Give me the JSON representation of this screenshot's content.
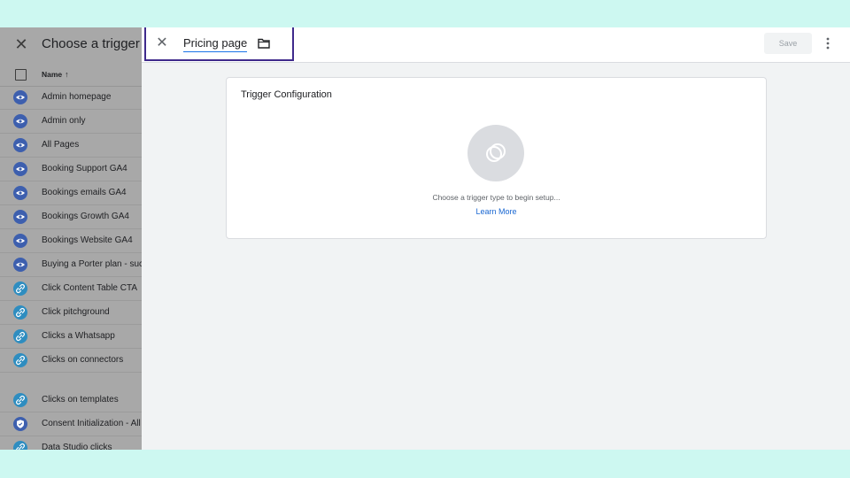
{
  "left_panel": {
    "close_icon": "close-icon",
    "title": "Choose a trigger",
    "column_header": {
      "name": "Name",
      "sort_arrow": "↑"
    },
    "triggers": [
      {
        "name": "Admin homepage",
        "icon": "pageview-eye-icon"
      },
      {
        "name": "Admin only",
        "icon": "pageview-eye-icon"
      },
      {
        "name": "All Pages",
        "icon": "pageview-eye-icon"
      },
      {
        "name": "Booking Support GA4",
        "icon": "pageview-eye-icon"
      },
      {
        "name": "Bookings emails GA4",
        "icon": "pageview-eye-icon"
      },
      {
        "name": "Bookings Growth GA4",
        "icon": "pageview-eye-icon"
      },
      {
        "name": "Bookings Website GA4",
        "icon": "pageview-eye-icon"
      },
      {
        "name": "Buying a Porter plan - success",
        "icon": "pageview-eye-icon"
      },
      {
        "name": "Click Content Table CTA",
        "icon": "link-click-icon"
      },
      {
        "name": "Click pitchground",
        "icon": "link-click-icon"
      },
      {
        "name": "Clicks a Whatsapp",
        "icon": "link-click-icon"
      },
      {
        "name": "Clicks on connectors",
        "icon": "link-click-icon"
      },
      {
        "name": "Clicks on templates",
        "icon": "link-click-icon"
      },
      {
        "name": "Consent Initialization - All Pages",
        "icon": "consent-shield-icon"
      },
      {
        "name": "Data Studio clicks",
        "icon": "link-click-icon"
      }
    ]
  },
  "editor": {
    "close_icon": "close-icon",
    "trigger_name": "Pricing page",
    "folder_icon": "folder-icon",
    "save_label": "Save",
    "more_icon": "more-vert-icon",
    "config_card": {
      "title": "Trigger Configuration",
      "hint": "Choose a trigger type to begin setup...",
      "learn_more": "Learn More"
    }
  },
  "colors": {
    "background": "#cdf8f1",
    "highlight_border": "#3f2a8c",
    "accent_blue": "#1a73e8",
    "pageview_icon": "#3d5fae",
    "click_icon": "#2e8dc0"
  }
}
